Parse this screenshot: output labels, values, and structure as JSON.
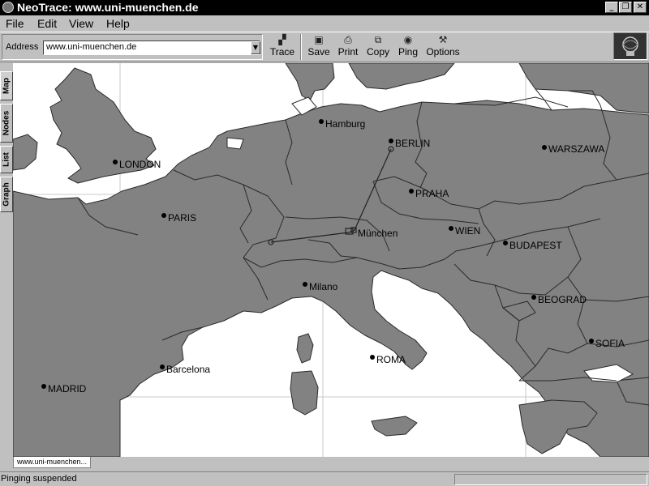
{
  "window": {
    "title": "NeoTrace: www.uni-muenchen.de"
  },
  "menu": {
    "file": "File",
    "edit": "Edit",
    "view": "View",
    "help": "Help"
  },
  "toolbar": {
    "address_label": "Address",
    "address_value": "www.uni-muenchen.de",
    "trace": "Trace",
    "save": "Save",
    "print": "Print",
    "copy": "Copy",
    "ping": "Ping",
    "options": "Options"
  },
  "side_tabs": {
    "map": "Map",
    "nodes": "Nodes",
    "list": "List",
    "graph": "Graph"
  },
  "map": {
    "cities": [
      {
        "name": "Hamburg"
      },
      {
        "name": "BERLIN"
      },
      {
        "name": "WARSZAWA"
      },
      {
        "name": "LONDON"
      },
      {
        "name": "PRAHA"
      },
      {
        "name": "PARIS"
      },
      {
        "name": "München"
      },
      {
        "name": "WIEN"
      },
      {
        "name": "BUDAPEST"
      },
      {
        "name": "Milano"
      },
      {
        "name": "BEOGRAD"
      },
      {
        "name": "SOFIA"
      },
      {
        "name": "ROMA"
      },
      {
        "name": "Barcelona"
      },
      {
        "name": "MADRID"
      }
    ]
  },
  "doc_tab": "www.uni-muenchen...",
  "status": {
    "text": "Pinging suspended"
  }
}
